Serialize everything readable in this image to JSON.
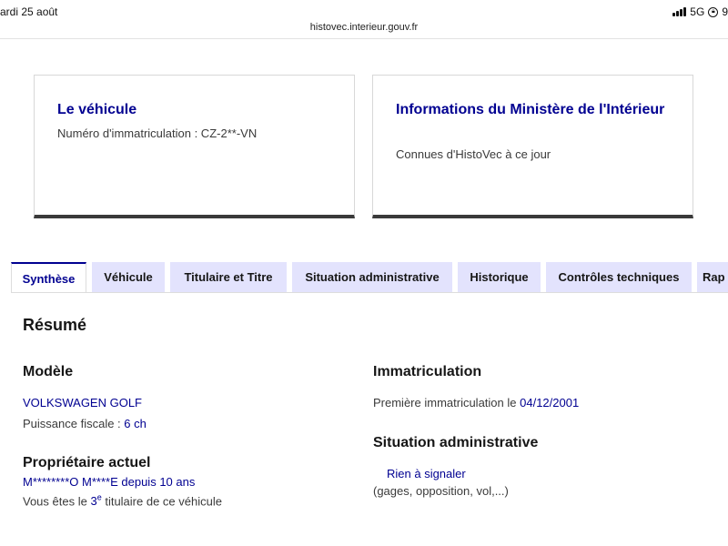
{
  "status_bar": {
    "date": "ardi 25 août",
    "network": "5G",
    "battery": "9"
  },
  "browser": {
    "url": "histovec.interieur.gouv.fr"
  },
  "cards": [
    {
      "title": "Le véhicule",
      "subtitle": "Numéro d'immatriculation : CZ-2**-VN"
    },
    {
      "title": "Informations du Ministère de l'Intérieur",
      "subtitle": "Connues d'HistoVec à ce jour"
    }
  ],
  "tabs": [
    {
      "label": "Synthèse",
      "active": true
    },
    {
      "label": "Véhicule"
    },
    {
      "label": "Titulaire et Titre"
    },
    {
      "label": "Situation administrative"
    },
    {
      "label": "Historique"
    },
    {
      "label": "Contrôles techniques"
    },
    {
      "label": "Rap"
    }
  ],
  "summary": {
    "title": "Résumé",
    "model": {
      "heading": "Modèle",
      "name": "VOLKSWAGEN GOLF",
      "power_label": "Puissance fiscale :",
      "power_value": "6 ch"
    },
    "owner": {
      "heading": "Propriétaire actuel",
      "name": "M********O M****E",
      "since_label": "depuis",
      "since_value": "10 ans",
      "rank_prefix": "Vous êtes le",
      "rank_value": "3",
      "rank_sup": "e",
      "rank_suffix": "titulaire de ce véhicule"
    },
    "registration": {
      "heading": "Immatriculation",
      "first_label": "Première immatriculation le",
      "first_date": "04/12/2001"
    },
    "admin": {
      "heading": "Situation administrative",
      "status": "Rien à signaler",
      "details": "(gages, opposition, vol,...)"
    }
  }
}
